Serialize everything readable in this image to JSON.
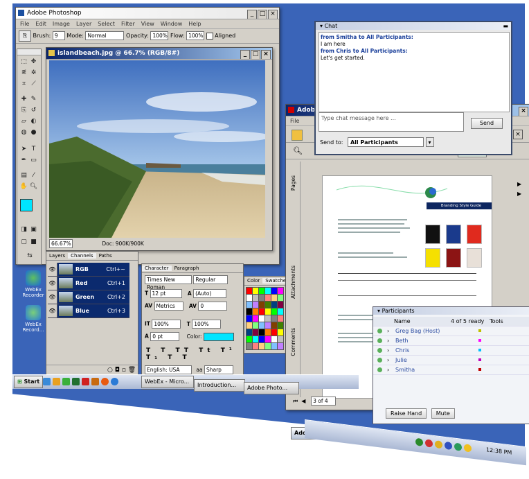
{
  "photoshop": {
    "title": "Adobe Photoshop",
    "menu": [
      "File",
      "Edit",
      "Image",
      "Layer",
      "Select",
      "Filter",
      "View",
      "Window",
      "Help"
    ],
    "options": {
      "brush_label": "Brush:",
      "brush_size": "9",
      "mode_label": "Mode:",
      "mode_value": "Normal",
      "opacity_label": "Opacity:",
      "opacity_value": "100%",
      "flow_label": "Flow:",
      "flow_value": "100%",
      "aligned_label": "Aligned"
    },
    "document": {
      "title": "islandbeach.jpg @ 66.7% (RGB/8#)",
      "zoom": "66.67%",
      "doc_info": "Doc: 900K/900K"
    },
    "channels": {
      "tabs": [
        "Layers",
        "Channels",
        "Paths"
      ],
      "rows": [
        {
          "name": "RGB",
          "shortcut": "Ctrl+~"
        },
        {
          "name": "Red",
          "shortcut": "Ctrl+1"
        },
        {
          "name": "Green",
          "shortcut": "Ctrl+2"
        },
        {
          "name": "Blue",
          "shortcut": "Ctrl+3"
        }
      ]
    },
    "character": {
      "tabs": [
        "Character",
        "Paragraph"
      ],
      "font_family": "Times New Roman",
      "font_style": "Regular",
      "size": "12 pt",
      "leading": "(Auto)",
      "kerning": "Metrics",
      "tracking": "0",
      "v_scale": "100%",
      "h_scale": "100%",
      "baseline": "0 pt",
      "color_label": "Color:",
      "language": "English: USA",
      "aa_label": "aa",
      "aa_value": "Sharp"
    },
    "swatches": {
      "tabs": [
        "Color",
        "Swatches"
      ]
    }
  },
  "desktop_icons": [
    {
      "label": "WebEx Recorder"
    },
    {
      "label": "WebEx Record..."
    }
  ],
  "chat": {
    "title": "Chat",
    "messages": [
      {
        "from": "from Smitha to All Participants:",
        "text": "I am here"
      },
      {
        "from": "from Chris to All Participants:",
        "text": "Let's get started."
      }
    ],
    "input_placeholder": "Type chat message here ...",
    "send_label": "Send",
    "send_to_label": "Send to:",
    "send_to_value": "All Participants"
  },
  "acrobat": {
    "title": "Adobe",
    "menu_file": "File",
    "side_tabs": [
      "Pages",
      "Attachments",
      "Comments"
    ],
    "page_indicator": "3 of 4",
    "document": {
      "banner": "Branding Style Guide",
      "swatch_colors": [
        "#111111",
        "#1a3a8c",
        "#e02a1e",
        "#f5e000",
        "#8c1414",
        "#e8e0d8"
      ]
    }
  },
  "participants": {
    "title": "Participants",
    "header_name": "Name",
    "header_status": "4 of 5 ready",
    "header_tools": "Tools",
    "rows": [
      {
        "name": "Greg Bag (Host)"
      },
      {
        "name": "Beth"
      },
      {
        "name": "Chris"
      },
      {
        "name": "Julie"
      },
      {
        "name": "Smitha"
      }
    ],
    "raise_hand": "Raise Hand",
    "mute": "Mute"
  },
  "taskbar": {
    "start": "Start",
    "buttons": [
      "WebEx - Micro...",
      "Introduction...",
      "Adobe Photo...",
      "Adobe Read..."
    ],
    "clock": "12:38 PM"
  },
  "colors": {
    "desktop": "#3a64b8",
    "foreground_swatch": "#00e5ff",
    "channel_row": "#0b2a6e",
    "chat_border": "#3a4a6a"
  }
}
